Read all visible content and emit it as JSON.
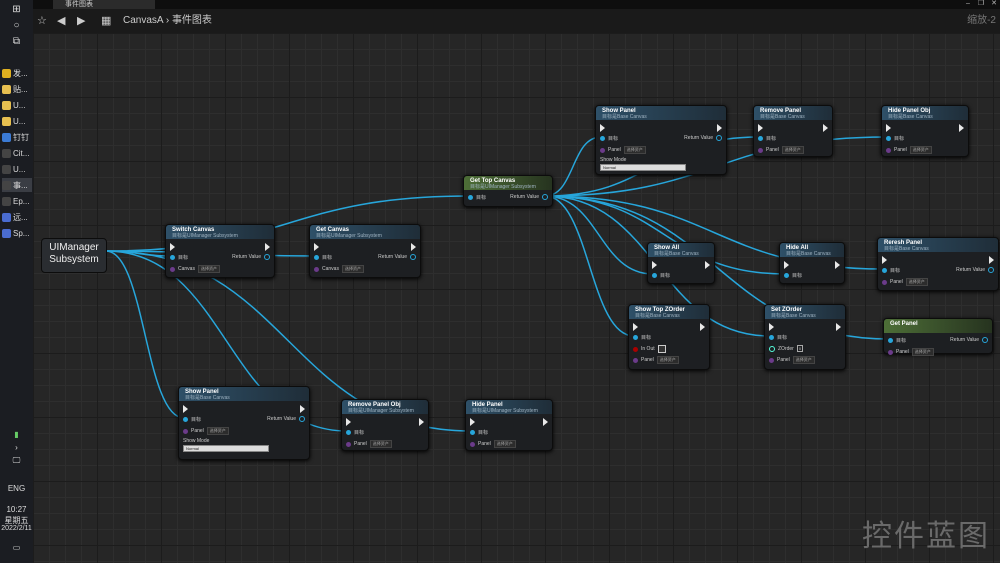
{
  "window": {
    "tab_label": "事件图表",
    "zoom": "缩放-2"
  },
  "toolbar": {
    "breadcrumb_root": "CanvasA",
    "breadcrumb_sep": "›",
    "breadcrumb_page": "事件图表"
  },
  "taskbar": {
    "items": [
      {
        "label": "发...",
        "color": "#e0b020"
      },
      {
        "label": "贴...",
        "color": "#e8c050"
      },
      {
        "label": "U...",
        "color": "#e8c050"
      },
      {
        "label": "U...",
        "color": "#e8c050"
      },
      {
        "label": "钉钉",
        "color": "#3b7bd6"
      },
      {
        "label": "Cit...",
        "color": "#444"
      },
      {
        "label": "U...",
        "color": "#444"
      },
      {
        "label": "事...",
        "color": "#444"
      },
      {
        "label": "Ep...",
        "color": "#444"
      },
      {
        "label": "远...",
        "color": "#4a6cd0"
      },
      {
        "label": "Sp...",
        "color": "#4a6cd0"
      }
    ],
    "lang": "ENG",
    "time": "10:27",
    "weekday": "星期五",
    "date": "2022/2/11"
  },
  "variable_node": {
    "label": "UIManager Subsystem"
  },
  "nodes": {
    "switch_canvas": {
      "title": "Switch Canvas",
      "sub": "目标是UIManager Subsystem",
      "target": "目标",
      "ret": "Return Value",
      "param": "Canvas",
      "dd": "选择资产"
    },
    "get_canvas": {
      "title": "Get Canvas",
      "sub": "目标是UIManager Subsystem",
      "target": "目标",
      "ret": "Return Value",
      "param": "Canvas",
      "dd": "选择资产"
    },
    "get_top_canvas": {
      "title": "Get Top Canvas",
      "sub": "目标是UIManager Subsystem",
      "target": "目标",
      "ret": "Return Value"
    },
    "show_panel_top": {
      "title": "Show Panel",
      "sub": "目标是Base Canvas",
      "target": "目标",
      "ret": "Return Value",
      "param": "Panel",
      "dd": "选择资产",
      "mode_label": "Show Mode",
      "mode_value": "Normal"
    },
    "remove_panel": {
      "title": "Remove Panel",
      "sub": "目标是Base Canvas",
      "target": "目标",
      "param": "Panel",
      "dd": "选择资产"
    },
    "hide_panel_obj": {
      "title": "Hide Panel Obj",
      "sub": "目标是Base Canvas",
      "target": "目标",
      "param": "Panel",
      "dd": "选择资产"
    },
    "show_all": {
      "title": "Show All",
      "sub": "目标是Base Canvas",
      "target": "目标"
    },
    "hide_all": {
      "title": "Hide All",
      "sub": "目标是Base Canvas",
      "target": "目标"
    },
    "refresh_panel": {
      "title": "Reresh Panel",
      "sub": "目标是Base Canvas",
      "target": "目标",
      "ret": "Return Value",
      "param": "Panel",
      "dd": "选择资产"
    },
    "show_top_zorder": {
      "title": "Show Top ZOrder",
      "sub": "目标是Base Canvas",
      "target": "目标",
      "in_out": "In Out",
      "param": "Panel",
      "dd": "选择资产"
    },
    "set_zorder": {
      "title": "Set ZOrder",
      "sub": "目标是Base Canvas",
      "target": "目标",
      "zorder": "ZOrder",
      "zorder_value": "0",
      "param": "Panel",
      "dd": "选择资产"
    },
    "get_panel": {
      "title": "Get Panel",
      "sub": "",
      "target": "目标",
      "ret": "Return Value",
      "param": "Panel",
      "dd": "选择资产"
    },
    "show_panel_bottom": {
      "title": "Show Panel",
      "sub": "目标是Base Canvas",
      "target": "目标",
      "ret": "Return Value",
      "param": "Panel",
      "dd": "选择资产",
      "mode_label": "Show Mode",
      "mode_value": "Normal"
    },
    "remove_panel_obj": {
      "title": "Remove Panel Obj",
      "sub": "目标是UIManager Subsystem",
      "target": "目标",
      "param": "Panel",
      "dd": "选择资产"
    },
    "hide_panel": {
      "title": "Hide Panel",
      "sub": "目标是UIManager Subsystem",
      "target": "目标",
      "param": "Panel",
      "dd": "选择资产"
    }
  },
  "watermark": "控件蓝图",
  "colors": {
    "wire": "#27a6db",
    "exec": "#e8e8e8",
    "func_header": "#2e5068",
    "pure_header": "#4d6e37"
  }
}
